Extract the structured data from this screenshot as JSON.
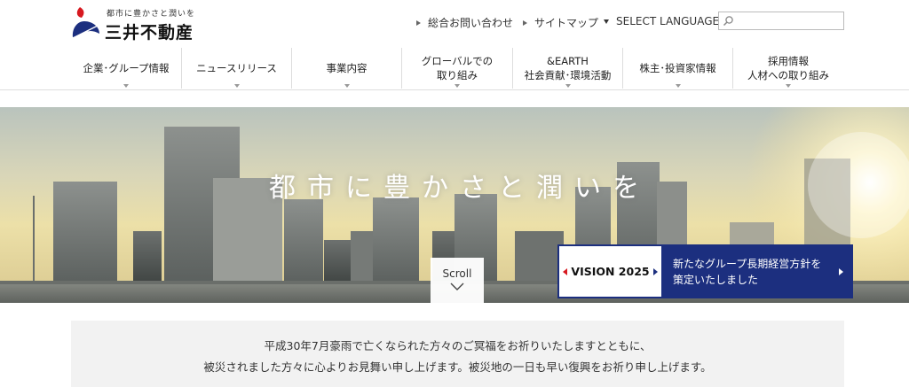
{
  "brand": {
    "tagline": "都市に豊かさと潤いを",
    "name": "三井不動産",
    "red": "#d71920",
    "blue": "#1c2f7f"
  },
  "utility": {
    "contact": "総合お問い合わせ",
    "sitemap": "サイトマップ",
    "language": "SELECT LANGUAGE",
    "search_placeholder": ""
  },
  "nav": {
    "items": [
      {
        "label": "企業･グループ情報"
      },
      {
        "label": "ニュースリリース"
      },
      {
        "label": "事業内容"
      },
      {
        "label": "グローバルでの\n取り組み"
      },
      {
        "label": "&EARTH\n社会貢献･環境活動"
      },
      {
        "label": "株主･投資家情報"
      },
      {
        "label": "採用情報\n人材への取り組み"
      }
    ]
  },
  "hero": {
    "tagline": "都市に豊かさと潤いを",
    "scroll_label": "Scroll",
    "vision": {
      "label": "VISION 2025",
      "text": "新たなグループ長期経営方針を\n策定いたしました"
    }
  },
  "notice": {
    "line1": "平成30年7月豪雨で亡くなられた方々のご冥福をお祈りいたしますとともに、",
    "line2": "被災されました方々に心よりお見舞い申し上げます。被災地の一日も早い復興をお祈り申し上げます。"
  }
}
